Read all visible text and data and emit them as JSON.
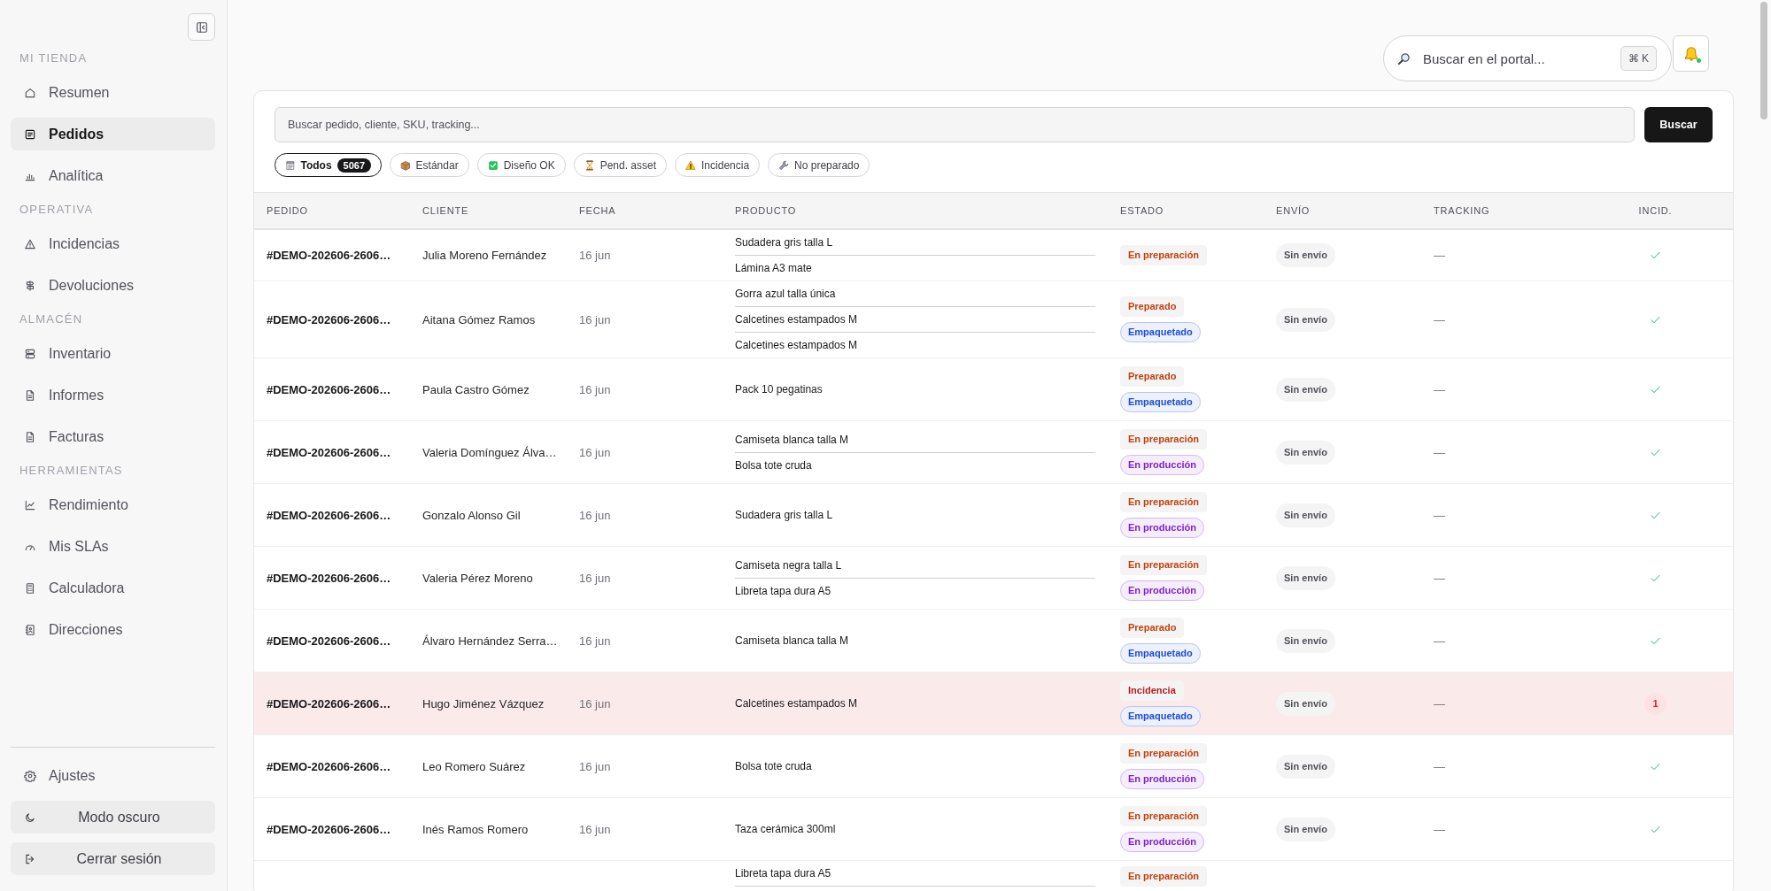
{
  "sidebar": {
    "sections": [
      {
        "title": "MI TIENDA",
        "items": [
          {
            "label": "Resumen",
            "selected": false
          },
          {
            "label": "Pedidos",
            "selected": true
          },
          {
            "label": "Analítica",
            "selected": false
          }
        ]
      },
      {
        "title": "OPERATIVA",
        "items": [
          {
            "label": "Incidencias",
            "selected": false
          },
          {
            "label": "Devoluciones",
            "selected": false
          }
        ]
      },
      {
        "title": "ALMACÉN",
        "items": [
          {
            "label": "Inventario",
            "selected": false
          },
          {
            "label": "Informes",
            "selected": false
          },
          {
            "label": "Facturas",
            "selected": false
          }
        ]
      },
      {
        "title": "HERRAMIENTAS",
        "items": [
          {
            "label": "Rendimiento",
            "selected": false
          },
          {
            "label": "Mis SLAs",
            "selected": false
          },
          {
            "label": "Calculadora",
            "selected": false
          },
          {
            "label": "Direcciones",
            "selected": false
          }
        ]
      }
    ],
    "footer": {
      "settings": "Ajustes",
      "buttons": [
        "Modo oscuro",
        "Cerrar sesión"
      ]
    }
  },
  "topbar": {
    "search": {
      "placeholder": "Buscar en el portal...",
      "shortcut": "⌘ K"
    },
    "notifications": {
      "indicator": true
    }
  },
  "orders": {
    "search": {
      "placeholder": "Buscar pedido, cliente, SKU, tracking...",
      "button": "Buscar"
    },
    "filters": [
      {
        "label": "Todos",
        "count": "5067",
        "selected": true
      },
      {
        "label": "Estándar",
        "selected": false
      },
      {
        "label": "Diseño OK",
        "selected": false
      },
      {
        "label": "Pend. asset",
        "selected": false
      },
      {
        "label": "Incidencia",
        "selected": false
      },
      {
        "label": "No preparado",
        "selected": false
      }
    ],
    "table": {
      "columns": [
        "PEDIDO",
        "CLIENTE",
        "FECHA",
        "PRODUCTO",
        "ESTADO",
        "ENVÍO",
        "TRACKING",
        "INCID."
      ],
      "rows": [
        {
          "order": "#DEMO-202606-2606…",
          "customer": "Julia Moreno Fernández",
          "date": "16 jun",
          "products": [
            "Sudadera gris talla L",
            "Lámina A3 mate"
          ],
          "status": [
            {
              "label": "En preparación",
              "kind": "status",
              "color": "#c2410c"
            }
          ],
          "shipping": "Sin envío",
          "tracking": "—",
          "incidents": {
            "kind": "ok"
          },
          "highlighted": false
        },
        {
          "order": "#DEMO-202606-2606…",
          "customer": "Aitana Gómez Ramos",
          "date": "16 jun",
          "products": [
            "Gorra azul talla única",
            "Calcetines estampados M",
            "Calcetines estampados M"
          ],
          "status": [
            {
              "label": "Preparado",
              "kind": "status",
              "color": "#c2410c"
            },
            {
              "label": "Empaquetado",
              "kind": "stage",
              "color": "#1d4ed8"
            }
          ],
          "shipping": "Sin envío",
          "tracking": "—",
          "incidents": {
            "kind": "ok"
          },
          "highlighted": false
        },
        {
          "order": "#DEMO-202606-2606…",
          "customer": "Paula Castro Gómez",
          "date": "16 jun",
          "products": [
            "Pack 10 pegatinas"
          ],
          "status": [
            {
              "label": "Preparado",
              "kind": "status",
              "color": "#c2410c"
            },
            {
              "label": "Empaquetado",
              "kind": "stage",
              "color": "#1d4ed8"
            }
          ],
          "shipping": "Sin envío",
          "tracking": "—",
          "incidents": {
            "kind": "ok"
          },
          "highlighted": false
        },
        {
          "order": "#DEMO-202606-2606…",
          "customer": "Valeria Domínguez Álva…",
          "date": "16 jun",
          "products": [
            "Camiseta blanca talla M",
            "Bolsa tote cruda"
          ],
          "status": [
            {
              "label": "En preparación",
              "kind": "status",
              "color": "#c2410c"
            },
            {
              "label": "En producción",
              "kind": "stage",
              "color": "#7e22ce"
            }
          ],
          "shipping": "Sin envío",
          "tracking": "—",
          "incidents": {
            "kind": "ok"
          },
          "highlighted": false
        },
        {
          "order": "#DEMO-202606-2606…",
          "customer": "Gonzalo Alonso Gil",
          "date": "16 jun",
          "products": [
            "Sudadera gris talla L"
          ],
          "status": [
            {
              "label": "En preparación",
              "kind": "status",
              "color": "#c2410c"
            },
            {
              "label": "En producción",
              "kind": "stage",
              "color": "#7e22ce"
            }
          ],
          "shipping": "Sin envío",
          "tracking": "—",
          "incidents": {
            "kind": "ok"
          },
          "highlighted": false
        },
        {
          "order": "#DEMO-202606-2606…",
          "customer": "Valeria Pérez Moreno",
          "date": "16 jun",
          "products": [
            "Camiseta negra talla L",
            "Libreta tapa dura A5"
          ],
          "status": [
            {
              "label": "En preparación",
              "kind": "status",
              "color": "#c2410c"
            },
            {
              "label": "En producción",
              "kind": "stage",
              "color": "#7e22ce"
            }
          ],
          "shipping": "Sin envío",
          "tracking": "—",
          "incidents": {
            "kind": "ok"
          },
          "highlighted": false
        },
        {
          "order": "#DEMO-202606-2606…",
          "customer": "Álvaro Hernández Serra…",
          "date": "16 jun",
          "products": [
            "Camiseta blanca talla M"
          ],
          "status": [
            {
              "label": "Preparado",
              "kind": "status",
              "color": "#c2410c"
            },
            {
              "label": "Empaquetado",
              "kind": "stage",
              "color": "#1d4ed8"
            }
          ],
          "shipping": "Sin envío",
          "tracking": "—",
          "incidents": {
            "kind": "ok"
          },
          "highlighted": false
        },
        {
          "order": "#DEMO-202606-2606…",
          "customer": "Hugo Jiménez Vázquez",
          "date": "16 jun",
          "products": [
            "Calcetines estampados M"
          ],
          "status": [
            {
              "label": "Incidencia",
              "kind": "status",
              "color": "#b91c1c"
            },
            {
              "label": "Empaquetado",
              "kind": "stage",
              "color": "#1d4ed8"
            }
          ],
          "shipping": "Sin envío",
          "tracking": "—",
          "incidents": {
            "kind": "count",
            "value": "1"
          },
          "highlighted": true
        },
        {
          "order": "#DEMO-202606-2606…",
          "customer": "Leo Romero Suárez",
          "date": "16 jun",
          "products": [
            "Bolsa tote cruda"
          ],
          "status": [
            {
              "label": "En preparación",
              "kind": "status",
              "color": "#c2410c"
            },
            {
              "label": "En producción",
              "kind": "stage",
              "color": "#7e22ce"
            }
          ],
          "shipping": "Sin envío",
          "tracking": "—",
          "incidents": {
            "kind": "ok"
          },
          "highlighted": false
        },
        {
          "order": "#DEMO-202606-2606…",
          "customer": "Inés Ramos Romero",
          "date": "16 jun",
          "products": [
            "Taza cerámica 300ml"
          ],
          "status": [
            {
              "label": "En preparación",
              "kind": "status",
              "color": "#c2410c"
            },
            {
              "label": "En producción",
              "kind": "stage",
              "color": "#7e22ce"
            }
          ],
          "shipping": "Sin envío",
          "tracking": "—",
          "incidents": {
            "kind": "ok"
          },
          "highlighted": false
        },
        {
          "products": [
            "Libreta tapa dura A5"
          ],
          "status": [
            {
              "label": "En preparación",
              "kind": "status",
              "color": "#c2410c"
            }
          ],
          "highlighted": false
        }
      ]
    }
  }
}
